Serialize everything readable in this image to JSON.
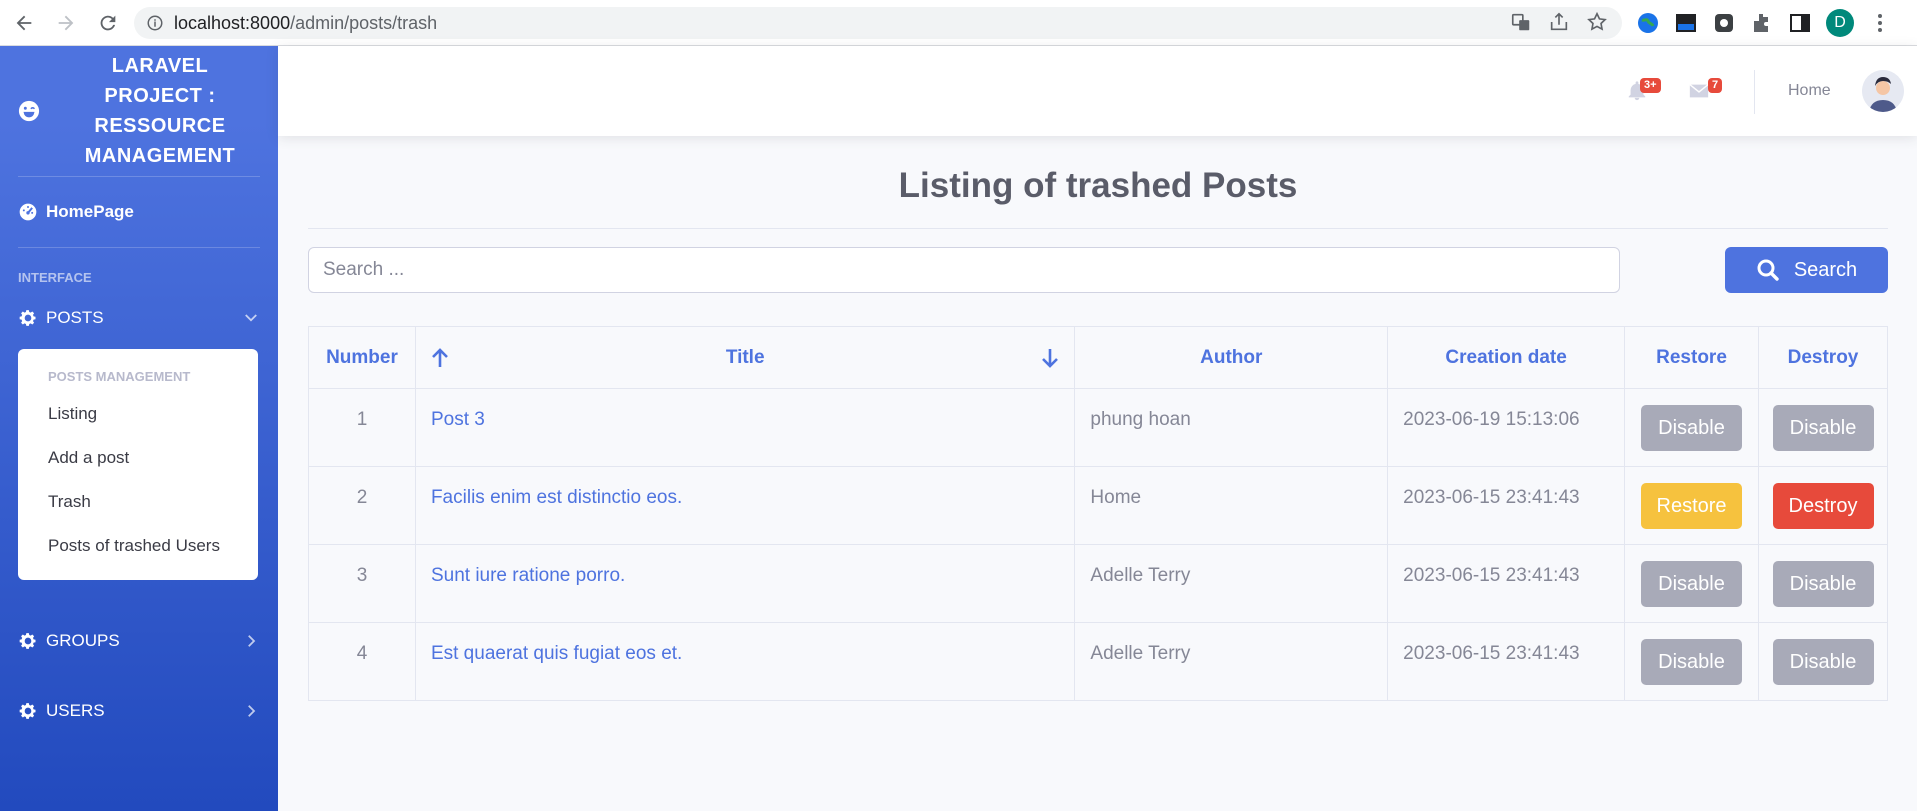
{
  "browser": {
    "url_host": "localhost:8000",
    "url_path": "/admin/posts/trash",
    "profile_initial": "D"
  },
  "sidebar": {
    "brand": "LARAVEL PROJECT : RESSOURCE MANAGEMENT",
    "home_label": "HomePage",
    "heading": "INTERFACE",
    "posts_label": "POSTS",
    "posts_menu": {
      "header": "POSTS MANAGEMENT",
      "items": [
        "Listing",
        "Add a post",
        "Trash",
        "Posts of trashed Users"
      ]
    },
    "groups_label": "GROUPS",
    "users_label": "USERS"
  },
  "topbar": {
    "alerts_badge": "3+",
    "messages_badge": "7",
    "user_name": "Home"
  },
  "page": {
    "title": "Listing of trashed Posts",
    "search_placeholder": "Search ...",
    "search_button": "Search"
  },
  "table": {
    "headers": [
      "Number",
      "Title",
      "Author",
      "Creation date",
      "Restore",
      "Destroy"
    ],
    "rows": [
      {
        "number": "1",
        "title": "Post 3",
        "author": "phung hoan",
        "date": "2023-06-19 15:13:06",
        "restore": "Disable",
        "destroy": "Disable"
      },
      {
        "number": "2",
        "title": "Facilis enim est distinctio eos.",
        "author": "Home",
        "date": "2023-06-15 23:41:43",
        "restore": "Restore",
        "destroy": "Destroy"
      },
      {
        "number": "3",
        "title": "Sunt iure ratione porro.",
        "author": "Adelle Terry",
        "date": "2023-06-15 23:41:43",
        "restore": "Disable",
        "destroy": "Disable"
      },
      {
        "number": "4",
        "title": "Est quaerat quis fugiat eos et.",
        "author": "Adelle Terry",
        "date": "2023-06-15 23:41:43",
        "restore": "Disable",
        "destroy": "Disable"
      }
    ]
  },
  "colors": {
    "primary": "#4e73df",
    "warning": "#f6c23e",
    "danger": "#e74a3b",
    "disabled": "#a8aab8"
  }
}
